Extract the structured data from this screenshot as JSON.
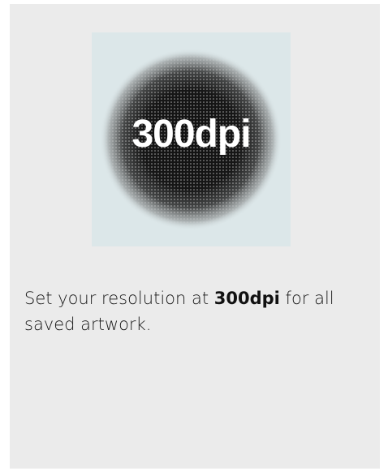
{
  "card": {
    "image": {
      "label": "300dpi"
    },
    "caption": {
      "before": "Set your resolution at ",
      "highlight": "300dpi",
      "after": " for all saved artwork."
    }
  },
  "colors": {
    "page_background": "#ffffff",
    "card_background": "#ebebeb",
    "image_background": "#dce7e9",
    "halftone_dark": "#111111",
    "text": "#1a1a1a"
  }
}
